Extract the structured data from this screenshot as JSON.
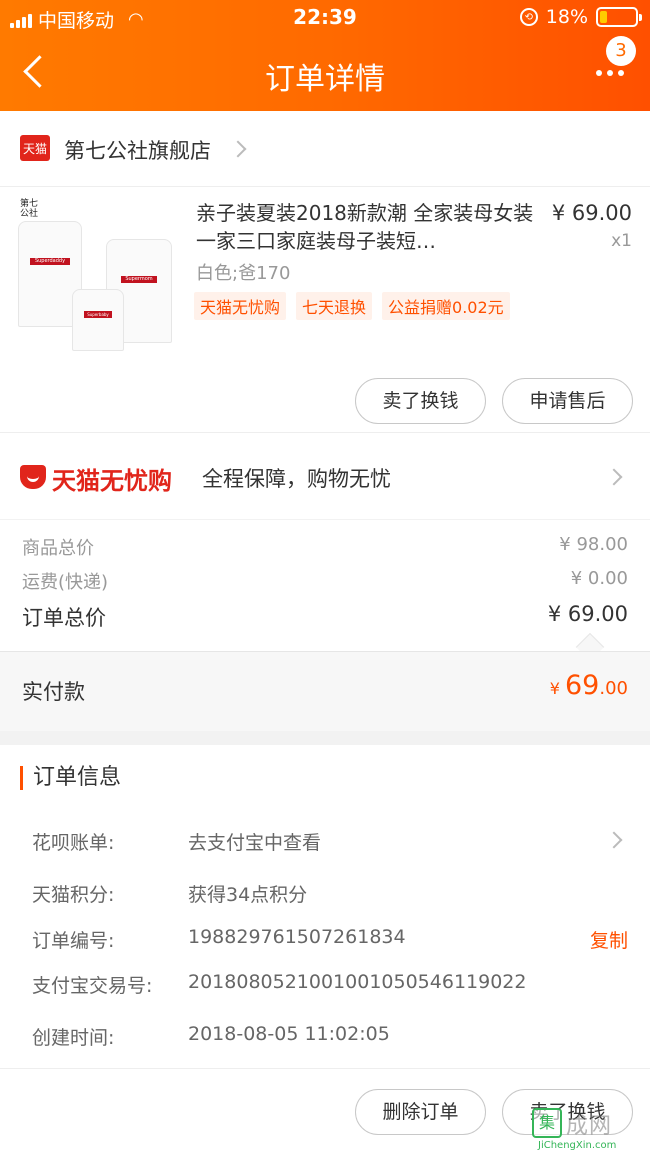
{
  "status_bar": {
    "carrier": "中国移动",
    "time": "22:39",
    "battery": "18%"
  },
  "nav": {
    "title": "订单详情",
    "badge_count": "3"
  },
  "store": {
    "logo_text": "天猫",
    "name": "第七公社旗舰店"
  },
  "product": {
    "title": "亲子装夏装2018新款潮 全家装母女装一家三口家庭装母子装短…",
    "price": "¥ 69.00",
    "quantity": "x1",
    "sku": "白色;爸170",
    "tags": [
      "天猫无忧购",
      "七天退换",
      "公益捐赠0.02元"
    ],
    "shirt_prints": [
      "Superdaddy",
      "Supermom",
      "Superbaby"
    ],
    "brand_mark": "第七公社"
  },
  "product_actions": {
    "sell_label": "卖了换钱",
    "after_sale_label": "申请售后"
  },
  "assurance": {
    "brand": "天猫无忧购",
    "text": "全程保障，购物无忧"
  },
  "prices": {
    "goods_total_label": "商品总价",
    "goods_total": "¥ 98.00",
    "shipping_label": "运费(快递)",
    "shipping": "¥ 0.00",
    "order_total_label": "订单总价",
    "order_total": "¥ 69.00",
    "paid_label": "实付款",
    "paid_currency": "¥ ",
    "paid_int": "69",
    "paid_dec": ".00"
  },
  "order_info": {
    "title": "订单信息",
    "huabei_label": "花呗账单:",
    "huabei_value": "去支付宝中查看",
    "points_label": "天猫积分:",
    "points_value": "获得34点积分",
    "order_no_label": "订单编号:",
    "order_no": "198829761507261834",
    "copy_label": "复制",
    "alipay_no_label": "支付宝交易号:",
    "alipay_no": "2018080521001001050546119022",
    "created_label": "创建时间:",
    "created": "2018-08-05 11:02:05"
  },
  "footer": {
    "delete_label": "删除订单",
    "sell_label": "卖了换钱"
  },
  "watermark": {
    "mark": "集",
    "text": "成网",
    "sub": "JiChengXin.com"
  },
  "colors": {
    "accent": "#ff5000",
    "tmall_red": "#e1251b",
    "header_start": "#ff7a00",
    "header_end": "#ff5000"
  }
}
